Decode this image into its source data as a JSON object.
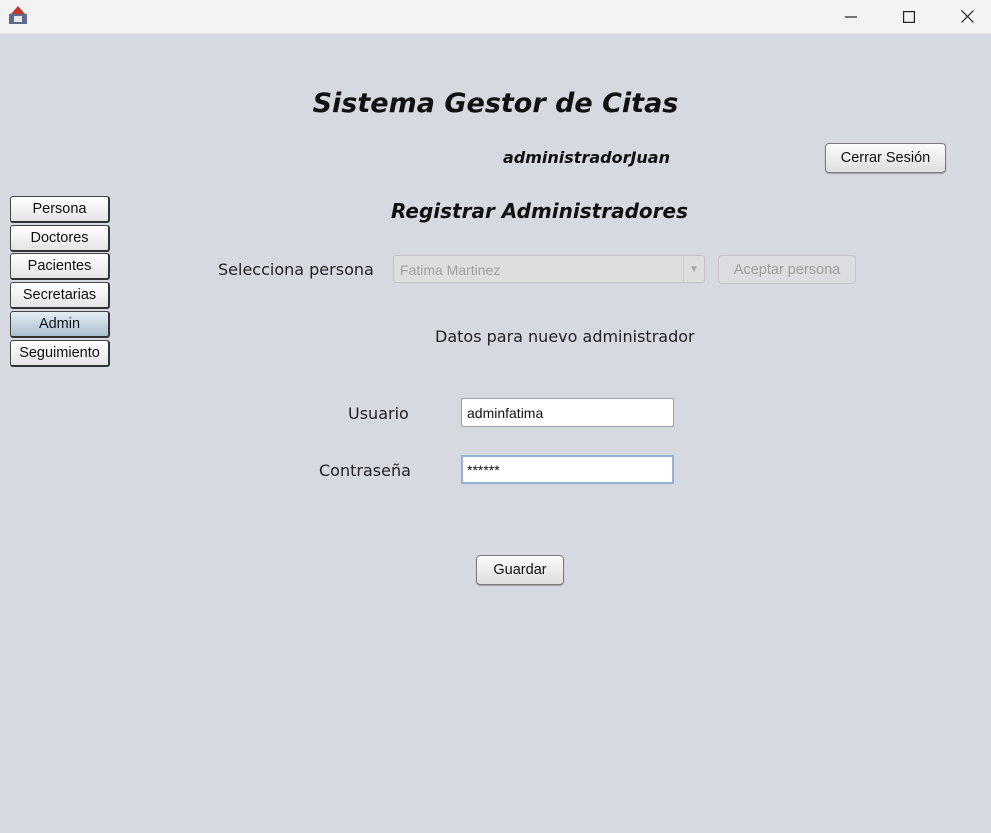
{
  "window": {
    "minimize_symbol": "—",
    "maximize_symbol": "☐",
    "close_symbol": "✕"
  },
  "header": {
    "title": "Sistema Gestor de Citas",
    "username": "administradorJuan",
    "logout_label": "Cerrar Sesión"
  },
  "sidebar": {
    "items": [
      {
        "label": "Persona"
      },
      {
        "label": "Doctores"
      },
      {
        "label": "Pacientes"
      },
      {
        "label": "Secretarias"
      },
      {
        "label": "Admin",
        "active": true
      },
      {
        "label": "Seguimiento"
      }
    ]
  },
  "form": {
    "section_title": "Registrar Administradores",
    "select_label": "Selecciona persona",
    "selected_person": "Fatima Martinez",
    "accept_label": "Aceptar persona",
    "subtitle": "Datos para nuevo administrador",
    "username_label": "Usuario",
    "username_value": "adminfatima",
    "password_label": "Contraseña",
    "password_value": "******",
    "save_label": "Guardar"
  },
  "colors": {
    "background": "#d6d9e0",
    "active_nav": "#a9bfd0"
  }
}
